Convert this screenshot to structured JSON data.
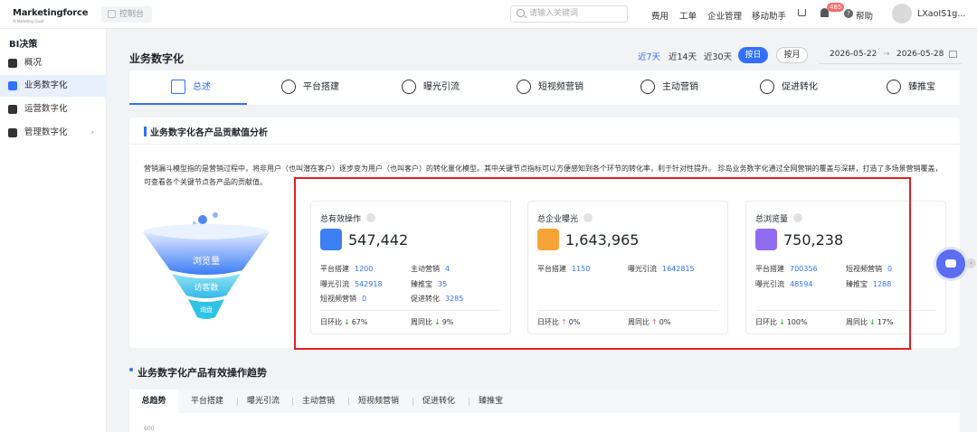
{
  "header": {
    "logo": "Marketingforce",
    "logo_sub": "AI Marketing Cloud",
    "home_label": "控制台",
    "search_placeholder": "请输入关键词",
    "nav": [
      "费用",
      "工单",
      "企业管理",
      "移动助手"
    ],
    "notification_count": "485",
    "help_label": "帮助",
    "username": "LXaoIS1g..."
  },
  "sidebar": {
    "title": "BI决策",
    "items": [
      {
        "label": "概况",
        "icon": "overview-icon"
      },
      {
        "label": "业务数字化",
        "icon": "business-icon",
        "active": true
      },
      {
        "label": "运营数字化",
        "icon": "operation-icon"
      },
      {
        "label": "管理数字化",
        "icon": "management-icon",
        "has_children": true
      }
    ]
  },
  "page": {
    "title": "业务数字化",
    "ranges": [
      "近7天",
      "近14天",
      "近30天"
    ],
    "active_range": "近7天",
    "btn_day": "按日",
    "btn_month": "按月",
    "date_start": "2026-05-22",
    "date_sep": "→",
    "date_end": "2026-05-28"
  },
  "tabs": [
    {
      "label": "总述",
      "icon": "chart-icon",
      "active": true
    },
    {
      "label": "平台搭建",
      "icon": "platform-icon"
    },
    {
      "label": "曝光引流",
      "icon": "exposure-icon"
    },
    {
      "label": "短视频营销",
      "icon": "video-icon"
    },
    {
      "label": "主动营销",
      "icon": "send-icon"
    },
    {
      "label": "促进转化",
      "icon": "convert-icon"
    },
    {
      "label": "臻推宝",
      "icon": "zhen-icon"
    }
  ],
  "section": {
    "title": "业务数字化各产品贡献值分析",
    "desc": "营销漏斗模型指的是营销过程中，将非用户（也叫潜在客户）逐步变为用户（也叫客户）的转化量化模型。其中关键节点指标可以方便感知到各个环节的转化率，利于针对性提升。 珍岛业务数字化通过全网营销的覆盖与深耕，打造了多场景营销覆盖，可查看各个关键节点各产品的贡献值。",
    "funnel": [
      "浏览量",
      "访客数",
      "询盘"
    ]
  },
  "cards": [
    {
      "title": "总有效操作",
      "value": "547,442",
      "items": [
        {
          "k": "平台搭建",
          "v": "1200"
        },
        {
          "k": "主动营销",
          "v": "4"
        },
        {
          "k": "曝光引流",
          "v": "542918"
        },
        {
          "k": "臻推宝",
          "v": "35"
        },
        {
          "k": "短视频营销",
          "v": "0"
        },
        {
          "k": "促进转化",
          "v": "3285"
        }
      ],
      "day_label": "日环比",
      "day_val": "67%",
      "day_dir": "down",
      "week_label": "周同比",
      "week_val": "9%",
      "week_dir": "down"
    },
    {
      "title": "总企业曝光",
      "value": "1,643,965",
      "items": [
        {
          "k": "平台搭建",
          "v": "1150"
        },
        {
          "k": "曝光引流",
          "v": "1642815"
        }
      ],
      "day_label": "日环比",
      "day_val": "0%",
      "day_dir": "up",
      "week_label": "周同比",
      "week_val": "0%",
      "week_dir": "up"
    },
    {
      "title": "总浏览量",
      "value": "750,238",
      "items": [
        {
          "k": "平台搭建",
          "v": "700356"
        },
        {
          "k": "短视频营销",
          "v": "0"
        },
        {
          "k": "曝光引流",
          "v": "48594"
        },
        {
          "k": "臻推宝",
          "v": "1288"
        }
      ],
      "day_label": "日环比",
      "day_val": "100%",
      "day_dir": "down",
      "week_label": "周同比",
      "week_val": "17%",
      "week_dir": "down"
    }
  ],
  "trend": {
    "title": "业务数字化产品有效操作趋势",
    "tabs": [
      "总趋势",
      "平台搭建",
      "曝光引流",
      "主动营销",
      "短视频营销",
      "促进转化",
      "臻推宝"
    ],
    "y_first_tick": "600"
  },
  "colors": {
    "accent": "#3370ff",
    "highlight_box": "#e02020",
    "up": "#f56c6c",
    "down": "#1aad19"
  }
}
